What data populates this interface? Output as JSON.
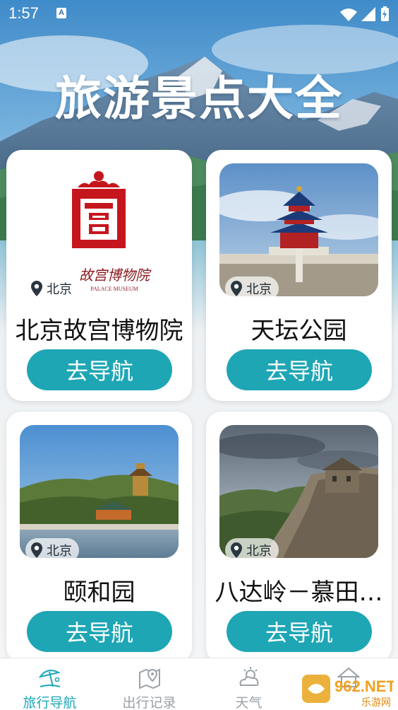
{
  "status_bar": {
    "time": "1:57",
    "notification_letter": "A"
  },
  "header": {
    "title": "旅游景点大全"
  },
  "cards": [
    {
      "title": "北京故宫博物院",
      "location": "北京",
      "button_label": "去导航",
      "image_icon": "palace-museum-logo",
      "logo_text_cn": "故宫博物院",
      "logo_text_en": "PALACE MUSEUM"
    },
    {
      "title": "天坛公园",
      "location": "北京",
      "button_label": "去导航",
      "image_icon": "temple-of-heaven-photo"
    },
    {
      "title": "颐和园",
      "location": "北京",
      "button_label": "去导航",
      "image_icon": "summer-palace-photo"
    },
    {
      "title": "八达岭－慕田…",
      "location": "北京",
      "button_label": "去导航",
      "image_icon": "great-wall-photo"
    }
  ],
  "tab_bar": {
    "tabs": [
      {
        "label": "旅行导航",
        "icon": "beach-umbrella-icon",
        "active": true
      },
      {
        "label": "出行记录",
        "icon": "map-pin-icon",
        "active": false
      },
      {
        "label": "天气",
        "icon": "weather-icon",
        "active": false
      },
      {
        "label": "",
        "icon": "home-icon",
        "active": false
      }
    ]
  },
  "watermark": {
    "text": "962.NET",
    "subtext": "乐游网"
  },
  "colors": {
    "accent": "#1ea6b5",
    "title_white": "#ffffff",
    "tab_inactive": "#9aa2a8"
  }
}
